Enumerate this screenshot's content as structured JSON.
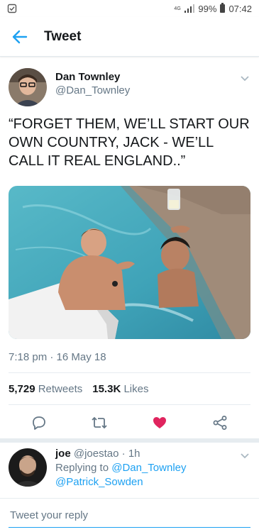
{
  "status_bar": {
    "network": "4G",
    "battery": "99%",
    "time": "07:42",
    "icons": [
      "notification-icon",
      "network-icon",
      "signal-icon",
      "battery-icon"
    ]
  },
  "header": {
    "title": "Tweet",
    "back_icon": "arrow-left-icon",
    "accent": "#1da1f2"
  },
  "tweet": {
    "author_name": "Dan Townley",
    "author_handle": "@Dan_Townley",
    "text": "“FORGET THEM, WE’LL START OUR OWN COUNTRY, JACK - WE’LL CALL IT REAL ENGLAND..”",
    "timestamp": "7:18 pm · 16 May 18",
    "retweets_count": "5,729",
    "retweets_label": "Retweets",
    "likes_count": "15.3K",
    "likes_label": "Likes",
    "liked": true,
    "like_color": "#e0245e"
  },
  "actions": [
    "reply-icon",
    "retweet-icon",
    "like-icon",
    "share-icon"
  ],
  "reply": {
    "name": "joe",
    "handle": "@joestao",
    "age": "1h",
    "replying_prefix": "Replying to",
    "mention_1": "@Dan_Townley",
    "mention_2": "@Patrick_Sowden"
  },
  "compose": {
    "placeholder": "Tweet your reply"
  }
}
